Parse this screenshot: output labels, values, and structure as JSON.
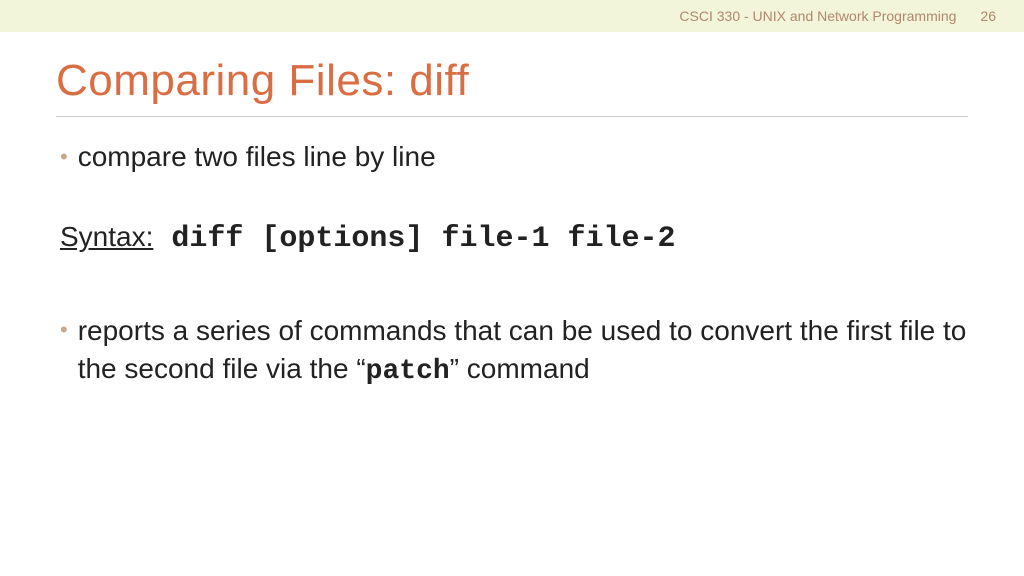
{
  "header": {
    "course": "CSCI 330 - UNIX and Network Programming",
    "slideNumber": "26"
  },
  "title": "Comparing Files: diff",
  "bullet1": "compare two files line by line",
  "syntax": {
    "label": "Syntax:",
    "code": " diff  [options]  file-1  file-2"
  },
  "bullet2": {
    "part1": "reports a series of commands that can be used to convert the first file to the second file via the “",
    "code": "patch",
    "part2": "” command"
  }
}
